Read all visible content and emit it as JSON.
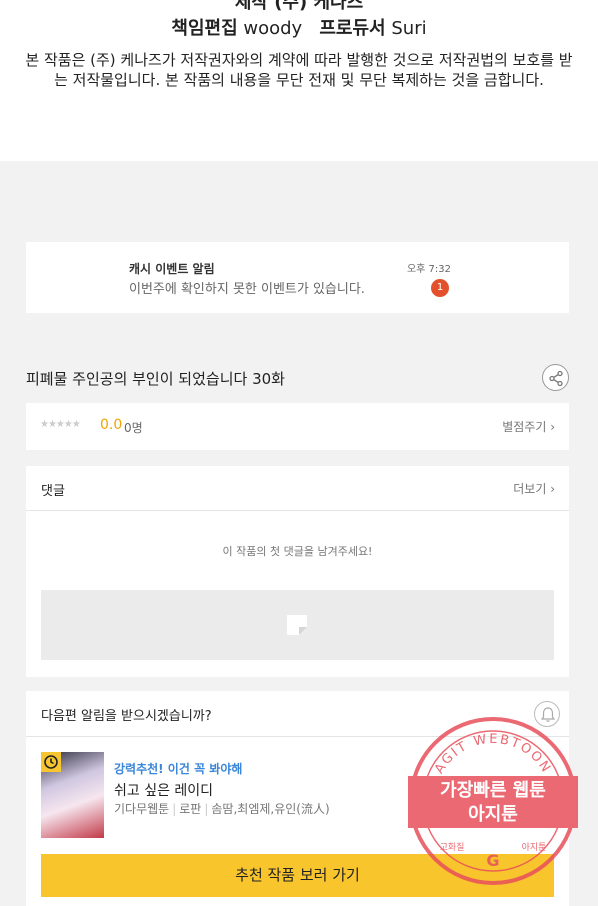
{
  "credits": {
    "cut_line": "제작 (주) 케나즈",
    "editor_label": "책임편집",
    "editor_name": "woody",
    "producer_label": "프로듀서",
    "producer_name": "Suri",
    "copyright": "본 작품은 (주) 케나즈가 저작권자와의 계약에 따라 발행한 것으로 저작권법의 보호를 받는 저작물입니다. 본 작품의 내용을 무단 전재 및 무단 복제하는 것을 금합니다."
  },
  "event": {
    "title": "캐시 이벤트 알림",
    "time": "오후 7:32",
    "message": "이번주에 확인하지 못한 이벤트가 있습니다.",
    "badge": "1"
  },
  "episode": {
    "title": "피폐물 주인공의 부인이 되었습니다 30화"
  },
  "rating": {
    "stars": "★★★★★",
    "score": "0.0",
    "count": "0명",
    "rate_label": "별점주기 ›"
  },
  "comments": {
    "title": "댓글",
    "more_label": "더보기 ›",
    "empty_message": "이 작품의 첫 댓글을 남겨주세요!"
  },
  "alarm": {
    "question": "다음편 알림을 받으시겠습니까?",
    "recommend_tag": "강력추천! 이건 꼭 봐야해",
    "recommend_title": "쉬고 싶은 레이디",
    "meta": [
      "기다무웹툰",
      "로판",
      "솜땀,최엠제,유인(流人)"
    ],
    "button_label": "추천 작품 보러 가기"
  },
  "watermark": {
    "arc_text": "AGIT WEBTOON",
    "line1": "가장빠른 웹툰",
    "line2": "아지툰",
    "bottom_left": "고화질",
    "bottom_right": "아지툰",
    "center_letter": "G"
  },
  "colors": {
    "accent_yellow": "#f9c52d",
    "score_orange": "#f0a500",
    "badge_red": "#e2512b",
    "link_blue": "#3a86d8",
    "stamp_red": "#e8505b"
  },
  "icons": {
    "share": "share-icon",
    "bell": "bell-icon",
    "ad_placeholder": "ad-placeholder-icon",
    "clock": "clock-icon"
  }
}
